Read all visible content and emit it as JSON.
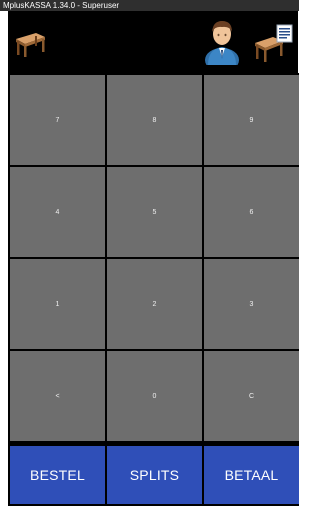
{
  "titlebar": {
    "text": "MplusKASSA 1.34.0 - Superuser"
  },
  "header": {
    "left_icon": "table-icon",
    "user_icon": "user-avatar-icon",
    "right_icon": "table-list-icon"
  },
  "keypad": {
    "rows": [
      [
        "7",
        "8",
        "9"
      ],
      [
        "4",
        "5",
        "6"
      ],
      [
        "1",
        "2",
        "3"
      ],
      [
        "<",
        "0",
        "C"
      ]
    ]
  },
  "actions": {
    "order_label": "BESTEL",
    "split_label": "SPLITS",
    "pay_label": "BETAAL"
  },
  "colors": {
    "header_bg": "#000000",
    "key_bg": "#6e6e6e",
    "action_bg": "#2f4fb8"
  }
}
